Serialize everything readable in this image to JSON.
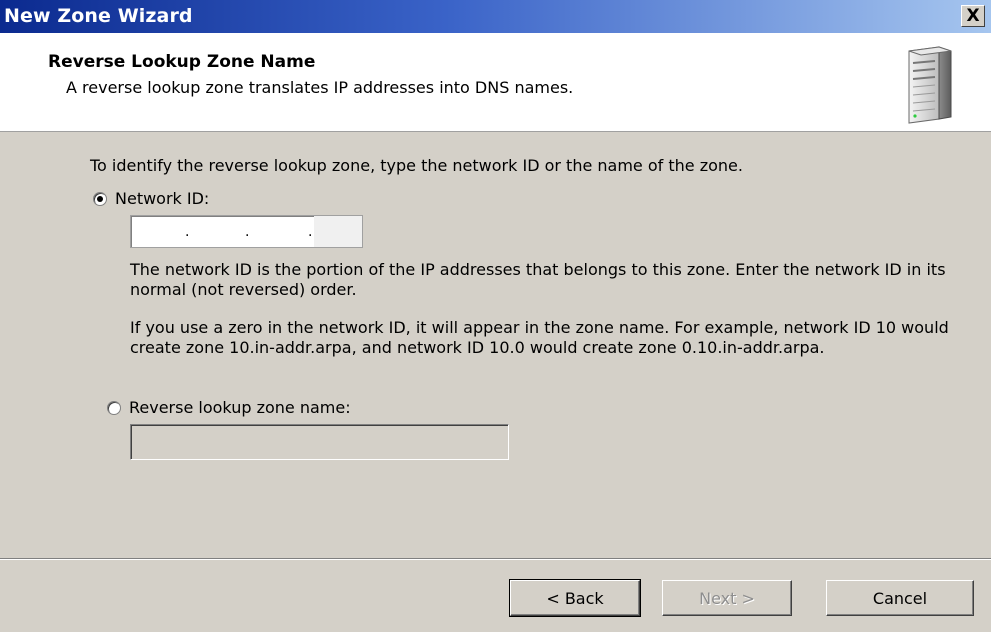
{
  "window": {
    "title": "New Zone Wizard",
    "close_label": "X"
  },
  "header": {
    "title": "Reverse Lookup Zone Name",
    "subtitle": "A reverse lookup zone translates IP addresses into DNS names.",
    "icon": "server-icon"
  },
  "body": {
    "instruction": "To identify the reverse lookup zone, type the network ID or the name of the zone.",
    "network_id": {
      "label": "Network ID:",
      "selected": true,
      "value": "",
      "help1": "The network ID is the portion of the IP addresses that belongs to this zone. Enter the network ID in its normal (not reversed) order.",
      "help2": "If you use a zero in the network ID, it will appear in the zone name. For example, network ID 10 would create zone 10.in-addr.arpa, and network ID 10.0 would create zone 0.10.in-addr.arpa."
    },
    "reverse_zone": {
      "label": "Reverse lookup zone name:",
      "selected": false,
      "value": ""
    }
  },
  "footer": {
    "back_label": "< Back",
    "next_label": "Next >",
    "cancel_label": "Cancel"
  }
}
